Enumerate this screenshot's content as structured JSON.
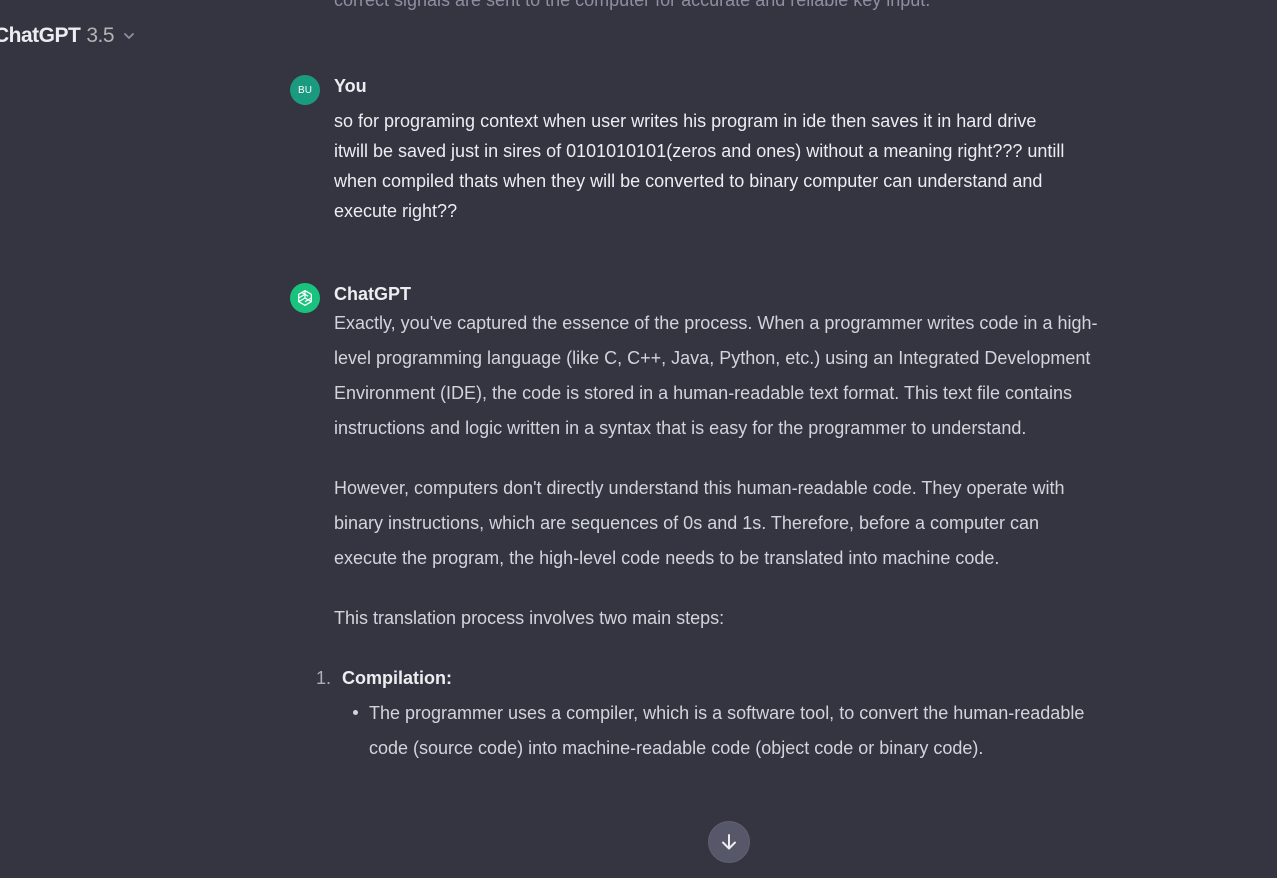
{
  "faded_previous_text": "correct signals are sent to the computer for accurate and reliable key input.",
  "model_selector": {
    "name": "ChatGPT",
    "version": "3.5",
    "icon": "chevron-down-icon"
  },
  "user_message": {
    "avatar_initials": "BU",
    "author": "You",
    "text": "so for programing context when user writes his program in ide then saves it in hard drive itwill be saved just in sires of 0101010101(zeros and ones) without a meaning right??? untill when compiled thats when they will be converted to binary computer can understand and execute right??"
  },
  "assistant_message": {
    "author": "ChatGPT",
    "avatar_icon": "openai-logo-icon",
    "paragraphs": [
      "Exactly, you've captured the essence of the process. When a programmer writes code in a high-level programming language (like C, C++, Java, Python, etc.) using an Integrated Development Environment (IDE), the code is stored in a human-readable text format. This text file contains instructions and logic written in a syntax that is easy for the programmer to understand.",
      "However, computers don't directly understand this human-readable code. They operate with binary instructions, which are sequences of 0s and 1s. Therefore, before a computer can execute the program, the high-level code needs to be translated into machine code.",
      "This translation process involves two main steps:"
    ],
    "steps": [
      {
        "number": "1.",
        "title": "Compilation:",
        "bullets": [
          "The programmer uses a compiler, which is a software tool, to convert the human-readable code (source code) into machine-readable code (object code or binary code)."
        ]
      }
    ]
  },
  "scroll_button": {
    "icon": "arrow-down-icon"
  }
}
